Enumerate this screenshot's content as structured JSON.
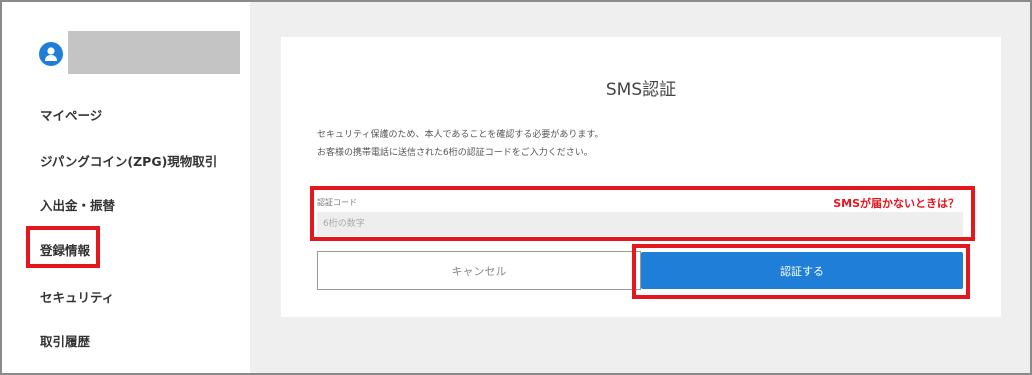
{
  "sidebar": {
    "avatar_icon": "user-circle-icon",
    "items": [
      {
        "label": "マイページ"
      },
      {
        "label": "ジパングコイン(ZPG)現物取引"
      },
      {
        "label": "入出金・振替"
      },
      {
        "label": "登録情報"
      },
      {
        "label": "セキュリティ"
      },
      {
        "label": "取引履歴"
      }
    ]
  },
  "main": {
    "title": "SMS認証",
    "description_line1": "セキュリティ保護のため、本人であることを確認する必要があります。",
    "description_line2": "お客様の携帯電話に送信された6桁の認証コードをご入力ください。",
    "code_label": "認証コード",
    "sms_link": "SMSが届かないときは？",
    "code_placeholder": "6桁の数字",
    "cancel_label": "キャンセル",
    "verify_label": "認証する"
  },
  "colors": {
    "accent": "#1f7fd8",
    "highlight": "#e4161e",
    "background": "#efefef"
  }
}
